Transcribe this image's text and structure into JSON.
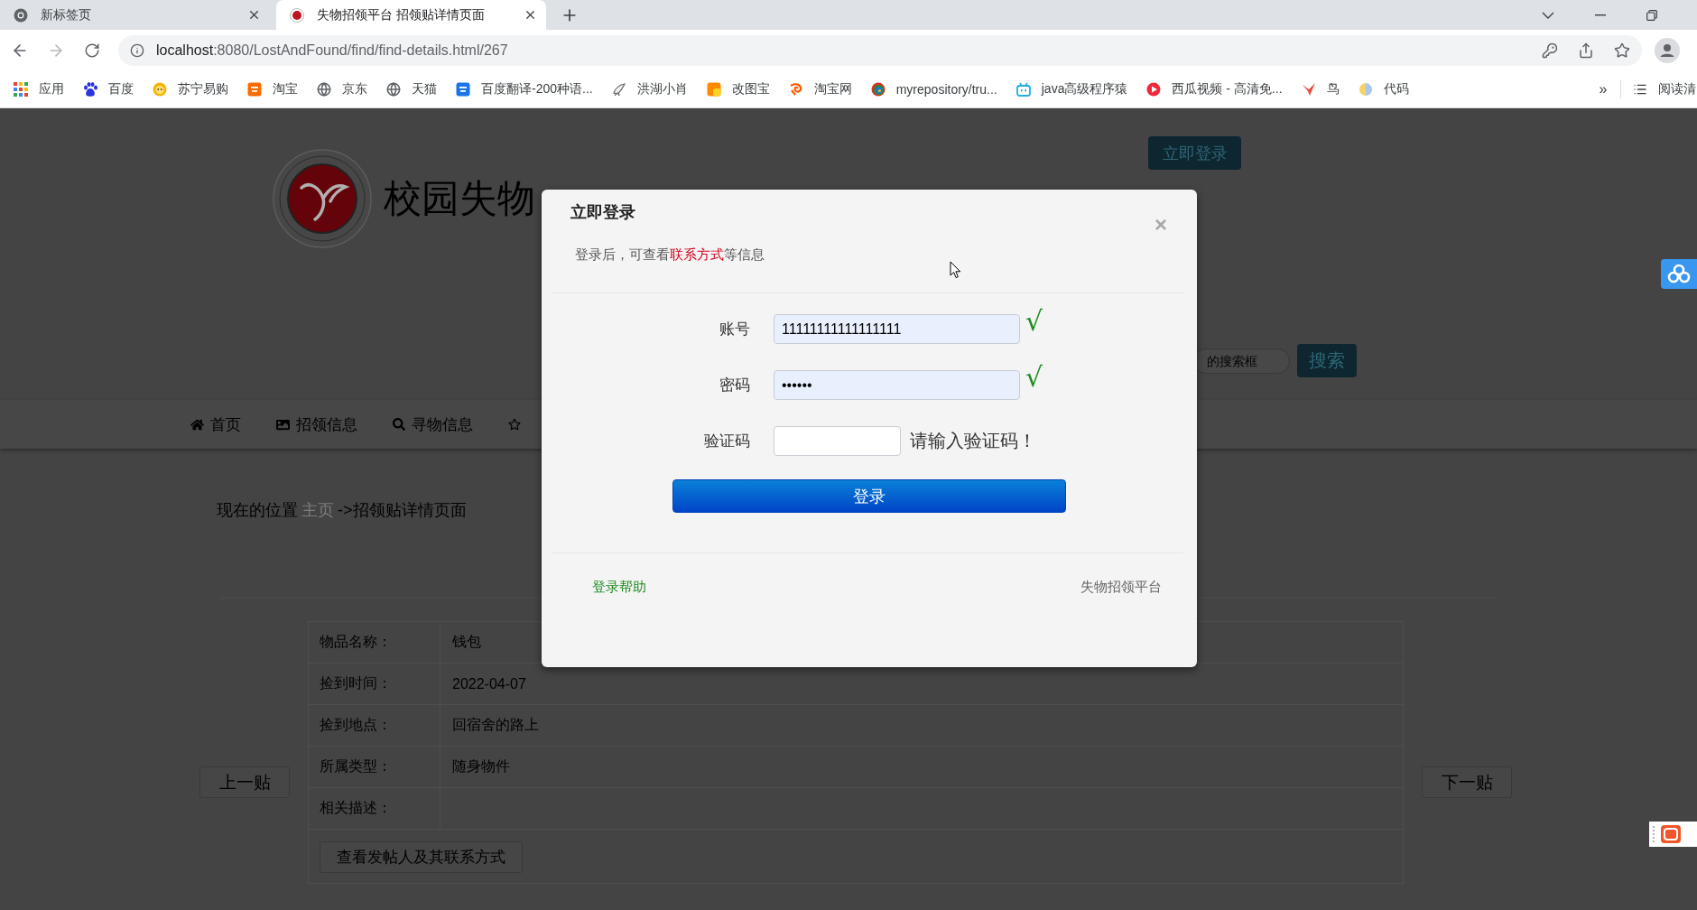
{
  "browser": {
    "tabs": [
      {
        "title": "新标签页",
        "selected": false
      },
      {
        "title": "失物招领平台 招领贴详情页面",
        "selected": true
      }
    ],
    "address": {
      "host": "localhost",
      "path": ":8080/LostAndFound/find/find-details.html/267"
    },
    "bookmarks": [
      {
        "label": "应用"
      },
      {
        "label": "百度"
      },
      {
        "label": "苏宁易购"
      },
      {
        "label": "淘宝"
      },
      {
        "label": "京东"
      },
      {
        "label": "天猫"
      },
      {
        "label": "百度翻译-200种语..."
      },
      {
        "label": "洪湖小肖"
      },
      {
        "label": "改图宝"
      },
      {
        "label": "淘宝网"
      },
      {
        "label": "myrepository/tru..."
      },
      {
        "label": "java高级程序猿"
      },
      {
        "label": "西瓜视频 - 高清免..."
      },
      {
        "label": "鸟"
      },
      {
        "label": "代码"
      }
    ],
    "bookmarks_more": "»",
    "reading_list": "阅读清"
  },
  "page": {
    "site_title": "校园失物",
    "login_button": "立即登录",
    "search": {
      "placeholder": "的搜索框",
      "button": "搜索"
    },
    "nav": [
      {
        "label": "首页"
      },
      {
        "label": "招领信息"
      },
      {
        "label": "寻物信息"
      }
    ],
    "breadcrumb": {
      "prefix": "现在的位置",
      "link": "主页",
      "current": "->招领贴详情页面"
    },
    "prev_button": "上一贴",
    "next_button": "下一贴",
    "details": [
      {
        "label": "物品名称：",
        "value": "钱包"
      },
      {
        "label": "捡到时间：",
        "value": "2022-04-07"
      },
      {
        "label": "捡到地点：",
        "value": "回宿舍的路上"
      },
      {
        "label": "所属类型：",
        "value": "随身物件"
      },
      {
        "label": "相关描述："
      }
    ],
    "contact_button": "查看发帖人及其联系方式"
  },
  "login_dialog": {
    "title": "立即登录",
    "close": "×",
    "notice": {
      "before": "登录后，可查看",
      "highlight": "联系方式",
      "after": "等信息"
    },
    "fields": [
      {
        "kind": "text",
        "label": "账号",
        "value": "11111111111111111",
        "mark": "√"
      },
      {
        "kind": "password",
        "label": "密码",
        "value": "••••••",
        "mark": "√"
      },
      {
        "kind": "captcha",
        "label": "验证码",
        "hint": "请输入验证码！"
      }
    ],
    "submit": "登录",
    "help_link": "登录帮助",
    "footer_brand": "失物招领平台"
  }
}
